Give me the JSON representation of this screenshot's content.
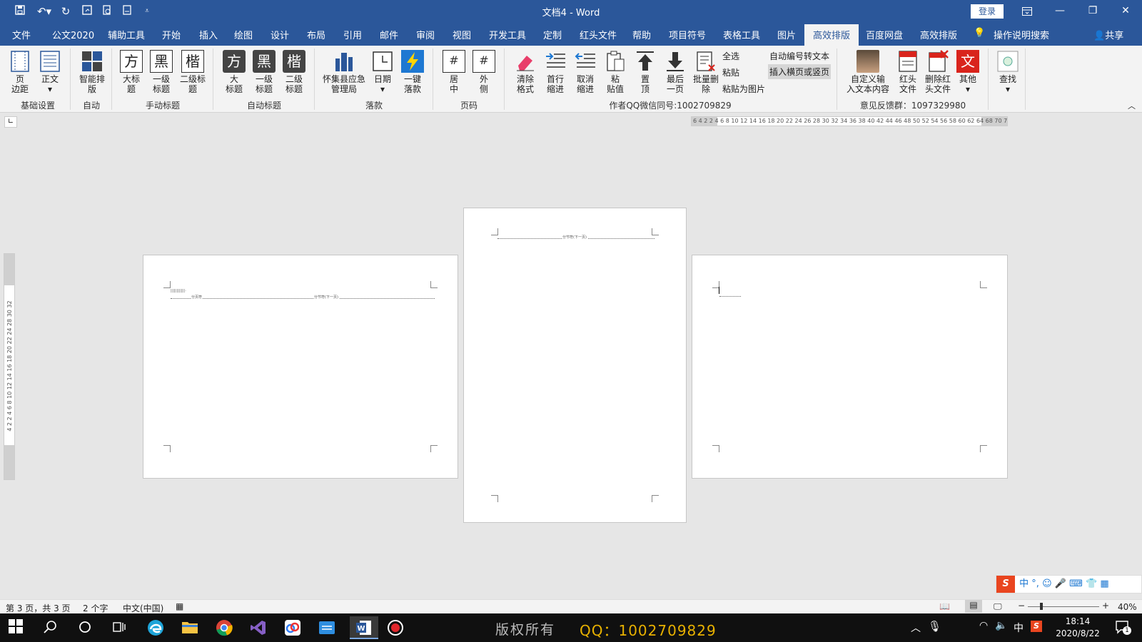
{
  "title": {
    "doc": "文档4",
    "sep": " - ",
    "app": "Word",
    "login": "登录"
  },
  "tabs": [
    "文件",
    "公文2020",
    "辅助工具",
    "开始",
    "插入",
    "绘图",
    "设计",
    "布局",
    "引用",
    "邮件",
    "审阅",
    "视图",
    "开发工具",
    "定制",
    "红头文件",
    "帮助",
    "项目符号",
    "表格工具",
    "图片",
    "高效排版",
    "百度网盘",
    "高效排版"
  ],
  "active_tab": "高效排版",
  "tell_me": "操作说明搜索",
  "share": "共享",
  "ribbon": {
    "margin": "页\n边距",
    "body": "正文",
    "smart": "智能排\n版",
    "big_title": "大标\n题",
    "l1_title": "一级\n标题",
    "l2_title": "二级标\n题",
    "a_big": "大\n标题",
    "a_l1": "一级\n标题",
    "a_l2": "二级\n标题",
    "org": "怀集县应急\n管理局",
    "date": "日期",
    "oneclick": "一键\n落款",
    "center": "居\n中",
    "outer": "外\n侧",
    "clear": "清除\n格式",
    "indent": "首行\n缩进",
    "unindent": "取消\n缩进",
    "paste_val": "粘\n贴值",
    "top": "置\n顶",
    "last": "最后\n一页",
    "batch_del": "批量删\n除",
    "select_all": "全选",
    "paste": "粘贴",
    "paste_pic": "粘贴为图片",
    "auto_num": "自动编号转文本",
    "insert_page": "插入横页或竖页",
    "custom": "自定义输\n入文本内容",
    "red_file": "红头\n文件",
    "del_red": "删除红\n头文件",
    "other": "其他",
    "find": "查找",
    "icon_fang": "方",
    "icon_hei": "黑",
    "icon_kai": "楷",
    "icon_wen": "文",
    "icon_hash": "#"
  },
  "groups": {
    "basic": "基础设置",
    "auto": "自动",
    "manual": "手动标题",
    "auto_title": "自动标题",
    "sign": "落款",
    "page_num": "页码",
    "author": "作者QQ微信同号:1002709829",
    "feedback": "意见反馈群：1097329980"
  },
  "ruler_h": "6 4 2   2  4  6  8 10 12 14 16 18 20 22 24 26 28 30 32 34 36 38 40 42 44 46 48 50 52 54 56 58 60 62 64  68 70 72",
  "ruler_v": "4 2   2 4 6 8 10 12 14 16 18 20 22 24   28 30 32",
  "pages": {
    "p1_small": "||||||||||||·",
    "p1_break1": "分页符",
    "p1_break2": "分节符(下一页)",
    "p2_break": "分节符(下一页)"
  },
  "status": {
    "page": "第 3 页，共 3 页",
    "words": "2 个字",
    "lang": "中文(中国)",
    "zoom": "40%"
  },
  "taskbar": {
    "watermark": "版权所有",
    "qq": "QQ：1002709829",
    "time": "18:14",
    "date": "2020/8/22",
    "ime": "中",
    "notif": "1"
  },
  "ime_bar": [
    "中",
    "°,",
    "☺",
    "🎤",
    "⌨",
    "👕",
    "▦"
  ],
  "colors": {
    "brand": "#2b579a",
    "red": "#d9241c",
    "taskbar": "#101010"
  }
}
